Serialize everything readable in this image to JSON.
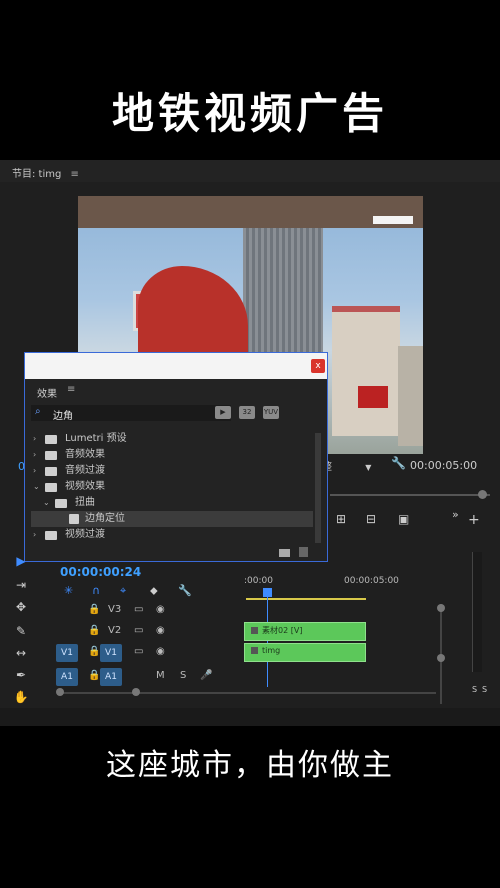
{
  "captions": {
    "top": "地铁视频广告",
    "bottom": "这座城市，由你做主"
  },
  "program_monitor": {
    "title": "节目: timg",
    "menu_icon": "≡",
    "timecode_left": "0",
    "fit_label": "整",
    "timecode_right": "00:00:05:00"
  },
  "effects_panel": {
    "title": "效果",
    "menu_icon": "≡",
    "search_value": "边角",
    "clear_icon": "×",
    "filter_buttons": [
      "▶",
      "32",
      "YUV"
    ],
    "items": [
      {
        "label": "Lumetri 预设",
        "level": 0,
        "expanded": false
      },
      {
        "label": "音频效果",
        "level": 0,
        "expanded": false
      },
      {
        "label": "音频过渡",
        "level": 0,
        "expanded": false
      },
      {
        "label": "视频效果",
        "level": 0,
        "expanded": true
      },
      {
        "label": "扭曲",
        "level": 1,
        "expanded": true
      },
      {
        "label": "边角定位",
        "level": 2,
        "expanded": false,
        "selected": true
      },
      {
        "label": "视频过渡",
        "level": 0,
        "expanded": false
      }
    ]
  },
  "close_label": "x",
  "timeline": {
    "timecode": "00:00:00:24",
    "ruler": [
      ":00:00",
      "00:00:05:00"
    ],
    "tracks": [
      {
        "name": "V3",
        "target": "",
        "eye": "◉",
        "lock": "🔒"
      },
      {
        "name": "V2",
        "target": "",
        "eye": "◉",
        "lock": "🔒"
      },
      {
        "name": "V1",
        "target": "V1",
        "eye": "◉",
        "lock": "🔒"
      },
      {
        "name": "A1",
        "target": "A1",
        "m": "M",
        "s": "S",
        "lock": "🔒"
      }
    ],
    "clips": [
      {
        "label": "素材02 [V]",
        "track": "V2"
      },
      {
        "label": "timg",
        "track": "V1"
      }
    ],
    "meter_labels": [
      "S",
      "S"
    ]
  }
}
